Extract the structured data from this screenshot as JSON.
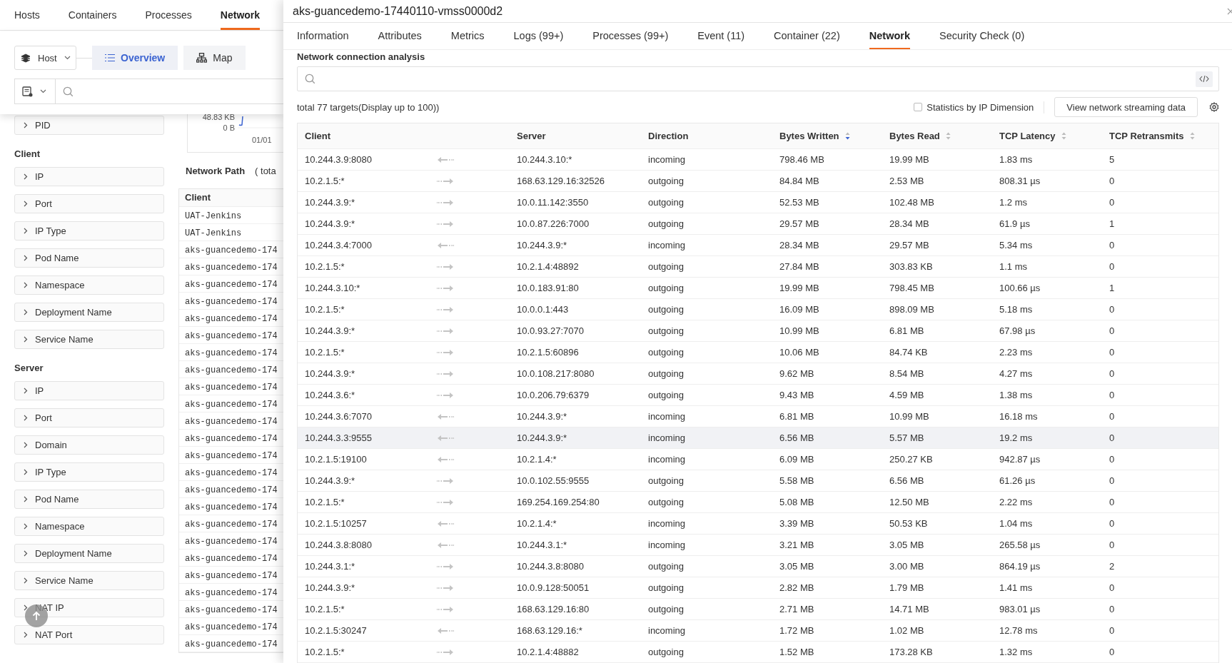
{
  "top_tabs": [
    {
      "label": "Hosts",
      "selected": false
    },
    {
      "label": "Containers",
      "selected": false
    },
    {
      "label": "Processes",
      "selected": false
    },
    {
      "label": "Network",
      "selected": true
    }
  ],
  "toolbar": {
    "host_select": "Host",
    "views": [
      {
        "label": "Overview",
        "selected": true,
        "kind": "list"
      },
      {
        "label": "Map",
        "selected": false,
        "kind": "map"
      }
    ]
  },
  "filters": [
    {
      "kind": "item",
      "label": "PID"
    },
    {
      "kind": "heading",
      "label": "Client"
    },
    {
      "kind": "item",
      "label": "IP"
    },
    {
      "kind": "item",
      "label": "Port"
    },
    {
      "kind": "item",
      "label": "IP Type"
    },
    {
      "kind": "item",
      "label": "Pod Name"
    },
    {
      "kind": "item",
      "label": "Namespace"
    },
    {
      "kind": "item",
      "label": "Deployment Name"
    },
    {
      "kind": "item",
      "label": "Service Name"
    },
    {
      "kind": "heading",
      "label": "Server"
    },
    {
      "kind": "item",
      "label": "IP"
    },
    {
      "kind": "item",
      "label": "Port"
    },
    {
      "kind": "item",
      "label": "Domain"
    },
    {
      "kind": "item",
      "label": "IP Type"
    },
    {
      "kind": "item",
      "label": "Pod Name"
    },
    {
      "kind": "item",
      "label": "Namespace"
    },
    {
      "kind": "item",
      "label": "Deployment Name"
    },
    {
      "kind": "item",
      "label": "Service Name"
    },
    {
      "kind": "item",
      "label": "NAT IP"
    },
    {
      "kind": "item",
      "label": "NAT Port"
    }
  ],
  "chart": {
    "y_labels": [
      "48.83 KB",
      "0 B"
    ],
    "x_label": "01/01"
  },
  "network_path": {
    "title": "Network Path",
    "total": "( tota",
    "column": "Client",
    "rows": [
      "UAT-Jenkins",
      "UAT-Jenkins",
      "aks-guancedemo-174",
      "aks-guancedemo-174",
      "aks-guancedemo-174",
      "aks-guancedemo-174",
      "aks-guancedemo-174",
      "aks-guancedemo-174",
      "aks-guancedemo-174",
      "aks-guancedemo-174",
      "aks-guancedemo-174",
      "aks-guancedemo-174",
      "aks-guancedemo-174",
      "aks-guancedemo-174",
      "aks-guancedemo-174",
      "aks-guancedemo-174",
      "aks-guancedemo-174",
      "aks-guancedemo-174",
      "aks-guancedemo-174",
      "aks-guancedemo-174",
      "aks-guancedemo-174",
      "aks-guancedemo-174",
      "aks-guancedemo-174",
      "aks-guancedemo-174",
      "aks-guancedemo-174",
      "aks-guancedemo-174"
    ]
  },
  "drawer": {
    "title": "aks-guancedemo-17440110-vmss0000d2",
    "tabs": [
      {
        "label": "Information",
        "selected": false
      },
      {
        "label": "Attributes",
        "selected": false
      },
      {
        "label": "Metrics",
        "selected": false
      },
      {
        "label": "Logs (99+)",
        "selected": false
      },
      {
        "label": "Processes (99+)",
        "selected": false
      },
      {
        "label": "Event (11)",
        "selected": false
      },
      {
        "label": "Container (22)",
        "selected": false
      },
      {
        "label": "Network",
        "selected": true
      },
      {
        "label": "Security Check (0)",
        "selected": false
      }
    ],
    "section_title": "Network connection analysis",
    "summary": "total 77 targets(Display up to 100))",
    "ip_dimension": {
      "label": "Statistics by IP Dimension",
      "checked": false
    },
    "stream_button": "View network streaming data",
    "columns": [
      {
        "label": "Client"
      },
      {
        "label": "Server"
      },
      {
        "label": "Direction"
      },
      {
        "label": "Bytes Written",
        "sorted": true
      },
      {
        "label": "Bytes Read",
        "sorted": false
      },
      {
        "label": "TCP Latency",
        "sorted": false
      },
      {
        "label": "TCP Retransmits",
        "sorted": false
      }
    ],
    "rows": [
      {
        "incoming": true,
        "selected": false,
        "cells": [
          "10.244.3.9:8080",
          "10.244.3.10:*",
          "incoming",
          "798.46 MB",
          "19.99 MB",
          "1.83 ms",
          "5"
        ]
      },
      {
        "incoming": false,
        "selected": false,
        "cells": [
          "10.2.1.5:*",
          "168.63.129.16:32526",
          "outgoing",
          "84.84 MB",
          "2.53 MB",
          "808.31 µs",
          "0"
        ]
      },
      {
        "incoming": false,
        "selected": false,
        "cells": [
          "10.244.3.9:*",
          "10.0.11.142:3550",
          "outgoing",
          "52.53 MB",
          "102.48 MB",
          "1.2 ms",
          "0"
        ]
      },
      {
        "incoming": false,
        "selected": false,
        "cells": [
          "10.244.3.9:*",
          "10.0.87.226:7000",
          "outgoing",
          "29.57 MB",
          "28.34 MB",
          "61.9 µs",
          "1"
        ]
      },
      {
        "incoming": true,
        "selected": false,
        "cells": [
          "10.244.3.4:7000",
          "10.244.3.9:*",
          "incoming",
          "28.34 MB",
          "29.57 MB",
          "5.34 ms",
          "0"
        ]
      },
      {
        "incoming": false,
        "selected": false,
        "cells": [
          "10.2.1.5:*",
          "10.2.1.4:48892",
          "outgoing",
          "27.84 MB",
          "303.83 KB",
          "1.1 ms",
          "0"
        ]
      },
      {
        "incoming": false,
        "selected": false,
        "cells": [
          "10.244.3.10:*",
          "10.0.183.91:80",
          "outgoing",
          "19.99 MB",
          "798.45 MB",
          "100.66 µs",
          "1"
        ]
      },
      {
        "incoming": false,
        "selected": false,
        "cells": [
          "10.2.1.5:*",
          "10.0.0.1:443",
          "outgoing",
          "16.09 MB",
          "898.09 MB",
          "5.18 ms",
          "0"
        ]
      },
      {
        "incoming": false,
        "selected": false,
        "cells": [
          "10.244.3.9:*",
          "10.0.93.27:7070",
          "outgoing",
          "10.99 MB",
          "6.81 MB",
          "67.98 µs",
          "0"
        ]
      },
      {
        "incoming": false,
        "selected": false,
        "cells": [
          "10.2.1.5:*",
          "10.2.1.5:60896",
          "outgoing",
          "10.06 MB",
          "84.74 KB",
          "2.23 ms",
          "0"
        ]
      },
      {
        "incoming": false,
        "selected": false,
        "cells": [
          "10.244.3.9:*",
          "10.0.108.217:8080",
          "outgoing",
          "9.62 MB",
          "8.54 MB",
          "4.27 ms",
          "0"
        ]
      },
      {
        "incoming": false,
        "selected": false,
        "cells": [
          "10.244.3.6:*",
          "10.0.206.79:6379",
          "outgoing",
          "9.43 MB",
          "4.59 MB",
          "1.38 ms",
          "0"
        ]
      },
      {
        "incoming": true,
        "selected": false,
        "cells": [
          "10.244.3.6:7070",
          "10.244.3.9:*",
          "incoming",
          "6.81 MB",
          "10.99 MB",
          "16.18 ms",
          "0"
        ]
      },
      {
        "incoming": true,
        "selected": true,
        "cells": [
          "10.244.3.3:9555",
          "10.244.3.9:*",
          "incoming",
          "6.56 MB",
          "5.57 MB",
          "19.2 ms",
          "0"
        ]
      },
      {
        "incoming": true,
        "selected": false,
        "cells": [
          "10.2.1.5:19100",
          "10.2.1.4:*",
          "incoming",
          "6.09 MB",
          "250.27 KB",
          "942.87 µs",
          "0"
        ]
      },
      {
        "incoming": false,
        "selected": false,
        "cells": [
          "10.244.3.9:*",
          "10.0.102.55:9555",
          "outgoing",
          "5.58 MB",
          "6.56 MB",
          "61.26 µs",
          "0"
        ]
      },
      {
        "incoming": false,
        "selected": false,
        "cells": [
          "10.2.1.5:*",
          "169.254.169.254:80",
          "outgoing",
          "5.08 MB",
          "12.50 MB",
          "2.22 ms",
          "0"
        ]
      },
      {
        "incoming": true,
        "selected": false,
        "cells": [
          "10.2.1.5:10257",
          "10.2.1.4:*",
          "incoming",
          "3.39 MB",
          "50.53 KB",
          "1.04 ms",
          "0"
        ]
      },
      {
        "incoming": true,
        "selected": false,
        "cells": [
          "10.244.3.8:8080",
          "10.244.3.1:*",
          "incoming",
          "3.21 MB",
          "3.05 MB",
          "265.58 µs",
          "0"
        ]
      },
      {
        "incoming": false,
        "selected": false,
        "cells": [
          "10.244.3.1:*",
          "10.244.3.8:8080",
          "outgoing",
          "3.05 MB",
          "3.00 MB",
          "864.19 µs",
          "2"
        ]
      },
      {
        "incoming": false,
        "selected": false,
        "cells": [
          "10.244.3.9:*",
          "10.0.9.128:50051",
          "outgoing",
          "2.82 MB",
          "1.79 MB",
          "1.41 ms",
          "0"
        ]
      },
      {
        "incoming": false,
        "selected": false,
        "cells": [
          "10.2.1.5:*",
          "168.63.129.16:80",
          "outgoing",
          "2.71 MB",
          "14.71 MB",
          "983.01 µs",
          "0"
        ]
      },
      {
        "incoming": true,
        "selected": false,
        "cells": [
          "10.2.1.5:30247",
          "168.63.129.16:*",
          "incoming",
          "1.72 MB",
          "1.02 MB",
          "12.78 ms",
          "0"
        ]
      },
      {
        "incoming": false,
        "selected": false,
        "cells": [
          "10.2.1.5:*",
          "10.2.1.4:48882",
          "outgoing",
          "1.52 MB",
          "173.28 KB",
          "1.32 ms",
          "0"
        ]
      }
    ]
  }
}
